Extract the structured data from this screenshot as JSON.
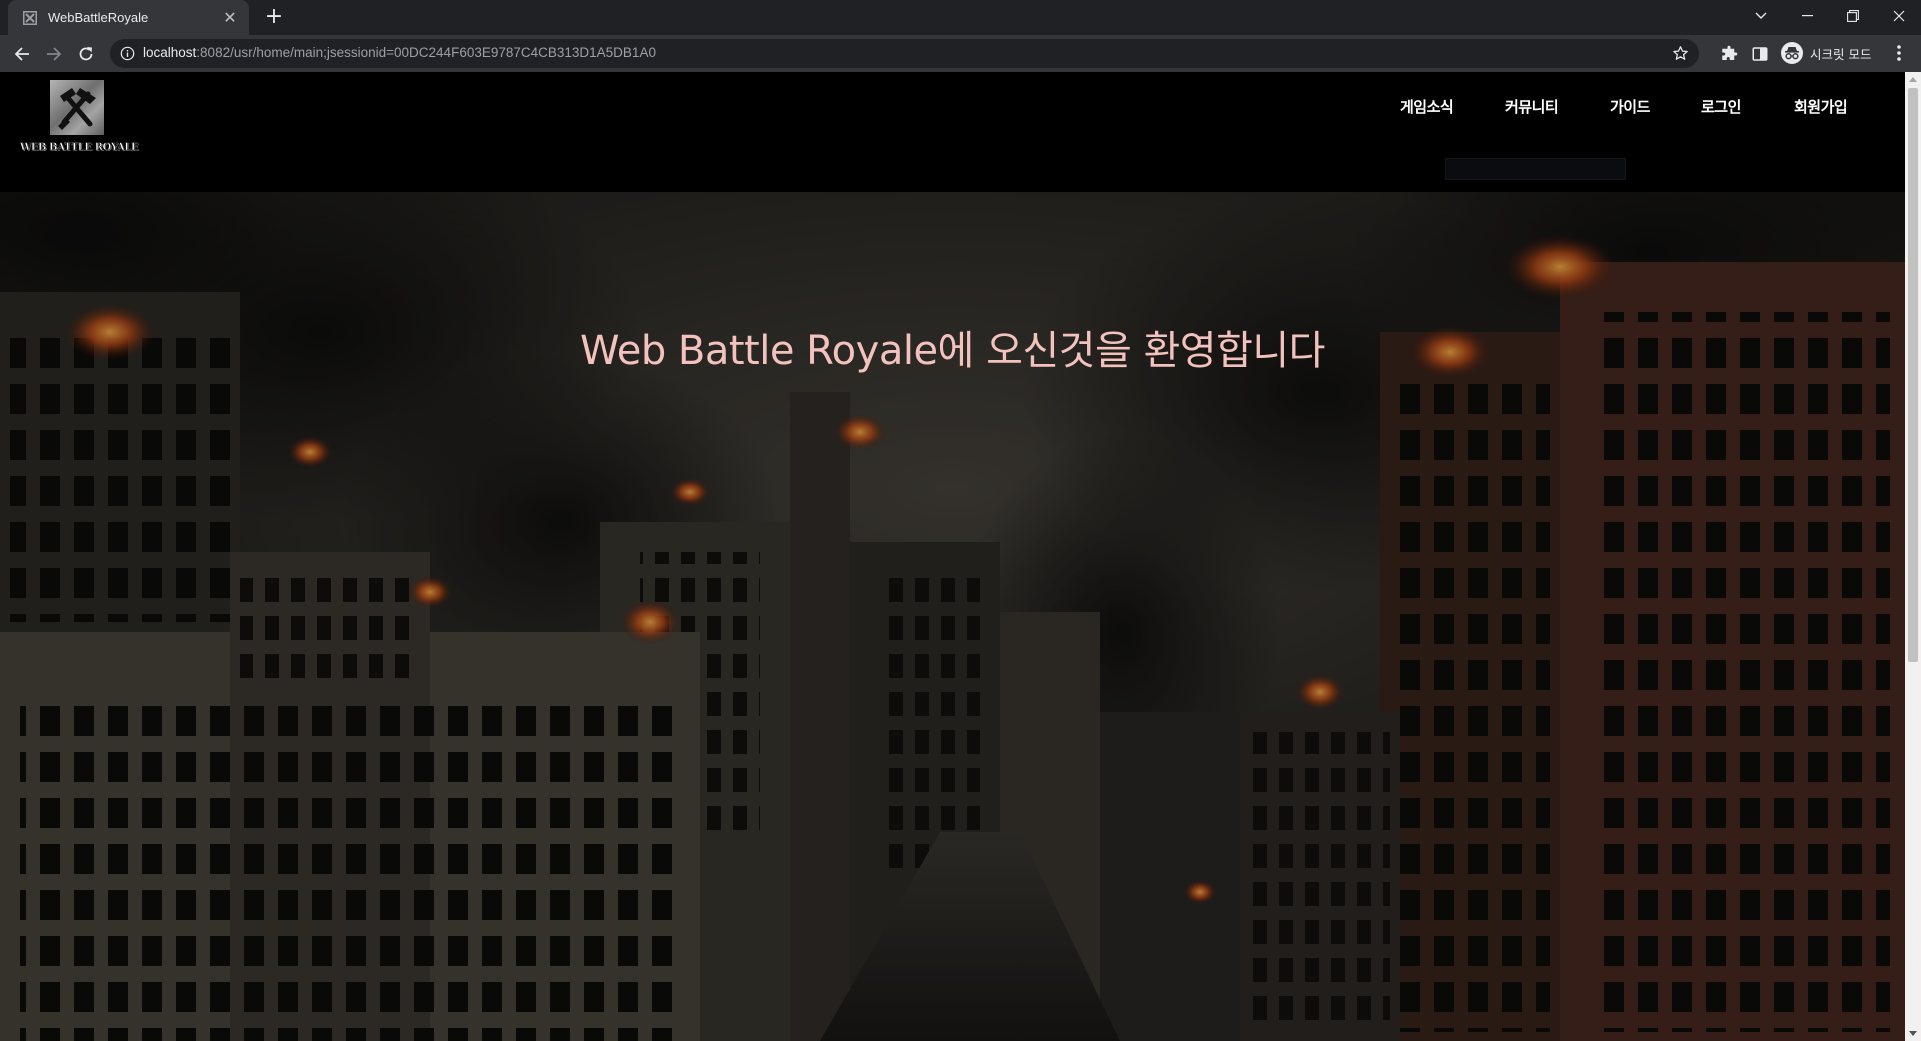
{
  "browser": {
    "tab": {
      "title": "WebBattleRoyale",
      "favicon": "close-square-icon"
    },
    "url": {
      "host": "localhost",
      "rest": ":8082/usr/home/main;jsessionid=00DC244F603E9787C4CB313D1A5DB1A0"
    },
    "incognito_label": "시크릿 모드",
    "icons": [
      "back-icon",
      "forward-icon",
      "reload-icon",
      "info-icon",
      "star-icon",
      "extensions-icon",
      "side-panel-icon",
      "incognito-icon",
      "menu-icon"
    ]
  },
  "site": {
    "logo_text": "WEB BATTLE ROYALE",
    "nav": {
      "news": "게임소식",
      "community": "커뮤니티",
      "guide": "가이드",
      "login": "로그인",
      "signup": "회원가입"
    },
    "hero": {
      "title": "Web Battle Royale에 오신것을 환영합니다"
    }
  },
  "colors": {
    "chrome_tabbar": "#202124",
    "chrome_toolbar": "#35363a",
    "page_header": "#000000",
    "hero_title": "#f3c2bd",
    "nav_text": "#ffffff"
  }
}
